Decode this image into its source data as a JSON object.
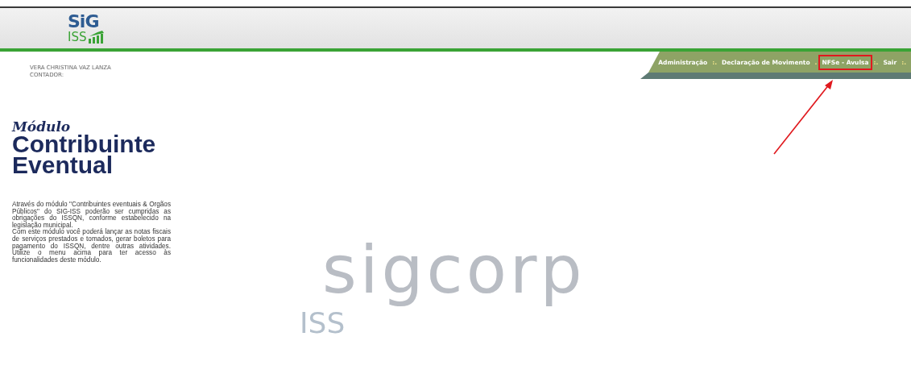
{
  "header": {
    "logo": {
      "top": "SiG",
      "bottom": "ISS"
    }
  },
  "user": {
    "name": "VERA CHRISTINA VAZ LANZA",
    "role": "CONTADOR:"
  },
  "menu": [
    {
      "label": "Administração",
      "separator": ":.",
      "highlighted": false
    },
    {
      "label": "Declaração de Movimento",
      "separator": ".",
      "highlighted": false
    },
    {
      "label": "NFSe - Avulsa",
      "separator": ":.",
      "highlighted": true
    },
    {
      "label": "Sair",
      "separator": ":.",
      "highlighted": false
    }
  ],
  "module": {
    "kicker": "Módulo",
    "title_lines": [
      "Contribuinte",
      "Eventual"
    ],
    "description": "Através do módulo \"Contribuintes eventuais & Orgãos Públicos\" do SIG-ISS poderão ser cumpridas as obrigações do ISSQN, conforme estabelecido na legislação municipal.\nCom este módulo você poderá lançar as notas fiscais de serviços prestados e tomados, gerar boletos para pagamento do ISSQN, dentre outras atividades. Utilize o menu acima para ter acesso às funcionalidades deste módulo."
  },
  "background_logo": {
    "name": "sigcorp",
    "sub": "ISS"
  }
}
